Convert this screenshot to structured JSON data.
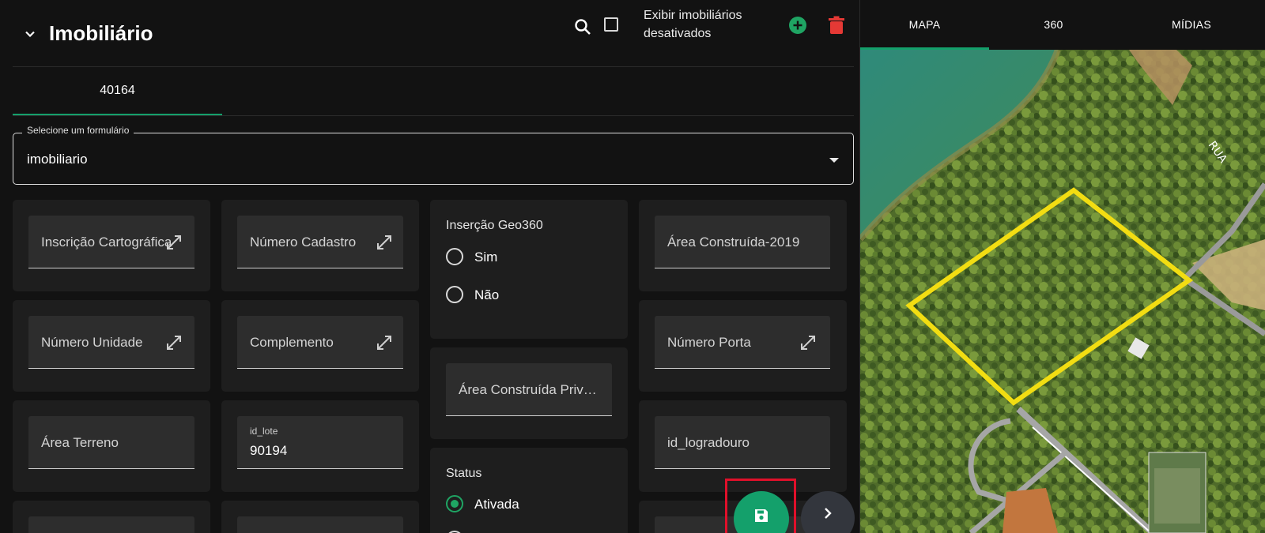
{
  "header": {
    "title": "Imobiliário",
    "show_disabled_label": "Exibir imobiliários desativados"
  },
  "tabs": [
    {
      "label": "40164"
    }
  ],
  "form_select": {
    "label": "Selecione um formulário",
    "value": "imobiliario"
  },
  "fields": {
    "inscricao": {
      "label": "Inscrição Cartográfica"
    },
    "numero_cadastro": {
      "label": "Número Cadastro"
    },
    "area_construida_2019": {
      "label": "Área Construída-2019"
    },
    "numero_unidade": {
      "label": "Número Unidade"
    },
    "complemento": {
      "label": "Complemento"
    },
    "numero_porta": {
      "label": "Número Porta"
    },
    "area_construida_priv": {
      "label": "Área Construída Priv…"
    },
    "area_terreno": {
      "label": "Área Terreno"
    },
    "id_lote": {
      "label": "id_lote",
      "value": "90194"
    },
    "id_logradouro": {
      "label": "id_logradouro"
    }
  },
  "geo360": {
    "title": "Inserção Geo360",
    "options": [
      {
        "label": "Sim",
        "selected": false
      },
      {
        "label": "Não",
        "selected": false
      }
    ]
  },
  "status": {
    "title": "Status",
    "options": [
      {
        "label": "Ativada",
        "selected": true
      }
    ]
  },
  "right_tabs": [
    {
      "label": "MAPA"
    },
    {
      "label": "360"
    },
    {
      "label": "MÍDIAS"
    }
  ],
  "map": {
    "street_label": "RUA"
  },
  "colors": {
    "accent": "#14a06b",
    "danger": "#e53935",
    "highlight": "#f2dd12"
  }
}
